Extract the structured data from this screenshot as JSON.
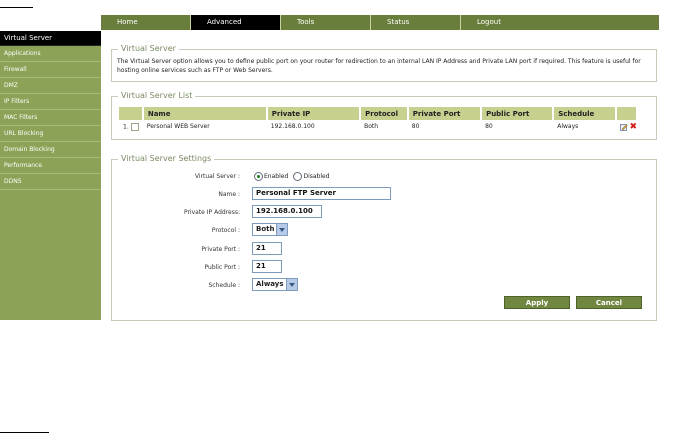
{
  "nav": {
    "tabs": [
      {
        "label": "Home"
      },
      {
        "label": "Advanced"
      },
      {
        "label": "Tools"
      },
      {
        "label": "Status"
      },
      {
        "label": "Logout"
      }
    ]
  },
  "sidebar": {
    "items": [
      {
        "label": "Virtual Server"
      },
      {
        "label": "Applications"
      },
      {
        "label": "Firewall"
      },
      {
        "label": "DMZ"
      },
      {
        "label": "IP Filters"
      },
      {
        "label": "MAC Filters"
      },
      {
        "label": "URL Blocking"
      },
      {
        "label": "Domain Blocking"
      },
      {
        "label": "Performance"
      },
      {
        "label": "DDNS"
      }
    ]
  },
  "intro": {
    "legend": "Virtual Server",
    "text": "The Virtual Server option allows you to define public port on your router for redirection to an internal LAN IP Address and Private LAN port if required. This feature is useful for hosting online services such as FTP or Web Servers."
  },
  "list": {
    "legend": "Virtual Server List",
    "headers": [
      "Name",
      "Private IP",
      "Protocol",
      "Private Port",
      "Public Port",
      "Schedule"
    ],
    "rows": [
      {
        "index": "1.",
        "name": "Personal WEB Server",
        "private_ip": "192.168.0.100",
        "protocol": "Both",
        "private_port": "80",
        "public_port": "80",
        "schedule": "Always"
      }
    ]
  },
  "settings": {
    "legend": "Virtual Server Settings",
    "virtual_server_label": "Virtual Server :",
    "enabled_label": "Enabled",
    "disabled_label": "Disabled",
    "name_label": "Name :",
    "name_value": "Personal FTP Server",
    "private_ip_label": "Private IP Address:",
    "private_ip_value": "192.168.0.100",
    "protocol_label": "Protocol :",
    "protocol_value": "Both",
    "private_port_label": "Private Port :",
    "private_port_value": "21",
    "public_port_label": "Public Port :",
    "public_port_value": "21",
    "schedule_label": "Schedule :",
    "schedule_value": "Always",
    "apply_label": "Apply",
    "cancel_label": "Cancel"
  },
  "colors": {
    "nav_bg": "#697e3a",
    "sidebar_bg": "#8ca256",
    "header_bg": "#c7d08e",
    "button_bg": "#6f8740"
  }
}
